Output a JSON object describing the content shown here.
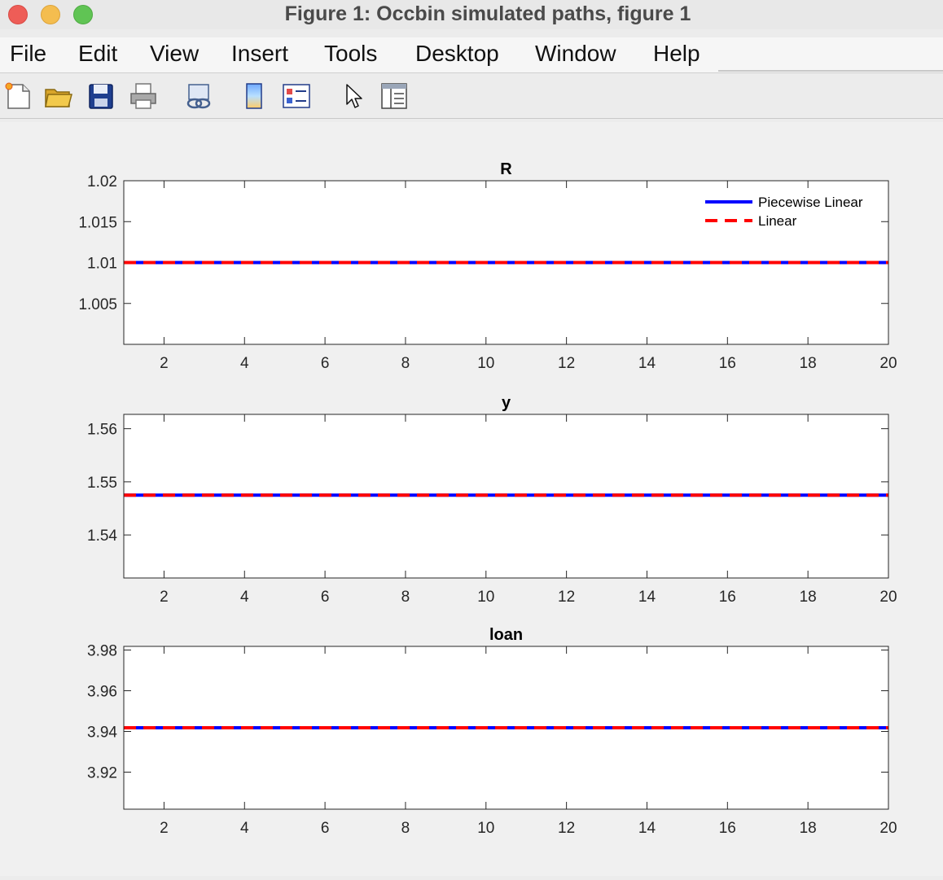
{
  "window": {
    "title": "Figure 1: Occbin simulated paths, figure 1"
  },
  "menu": [
    "File",
    "Edit",
    "View",
    "Insert",
    "Tools",
    "Desktop",
    "Window",
    "Help"
  ],
  "toolbar": [
    "new-figure-icon",
    "open-file-icon",
    "save-icon",
    "print-icon",
    "link-icon",
    "colorbar-icon",
    "legend-icon",
    "pointer-icon",
    "property-inspector-icon"
  ],
  "colors": {
    "piecewise": "#0000ff",
    "linear": "#ff0000"
  },
  "chart_data": [
    {
      "type": "line",
      "title": "R",
      "xlim": [
        1,
        20
      ],
      "ylim": [
        1,
        1.02
      ],
      "xticks": [
        2,
        4,
        6,
        8,
        10,
        12,
        14,
        16,
        18,
        20
      ],
      "yticks": [
        1.005,
        1.01,
        1.015,
        1.02
      ],
      "ytick_labels": [
        "1.005",
        "1.01",
        "1.015",
        "1.02"
      ],
      "legend": {
        "position": "top-right",
        "entries": [
          "Piecewise Linear",
          "Linear"
        ]
      },
      "series": [
        {
          "name": "Piecewise Linear",
          "style": "solid",
          "x": [
            1,
            20
          ],
          "y": [
            1.01,
            1.01
          ]
        },
        {
          "name": "Linear",
          "style": "dashed",
          "x": [
            1,
            20
          ],
          "y": [
            1.01,
            1.01
          ]
        }
      ]
    },
    {
      "type": "line",
      "title": "y",
      "xlim": [
        1,
        20
      ],
      "ylim": [
        1.5319,
        1.5627
      ],
      "xticks": [
        2,
        4,
        6,
        8,
        10,
        12,
        14,
        16,
        18,
        20
      ],
      "yticks": [
        1.54,
        1.55,
        1.56
      ],
      "ytick_labels": [
        "1.54",
        "1.55",
        "1.56"
      ],
      "series": [
        {
          "name": "Piecewise Linear",
          "style": "solid",
          "x": [
            1,
            20
          ],
          "y": [
            1.5475,
            1.5475
          ]
        },
        {
          "name": "Linear",
          "style": "dashed",
          "x": [
            1,
            20
          ],
          "y": [
            1.5475,
            1.5475
          ]
        }
      ]
    },
    {
      "type": "line",
      "title": "loan",
      "xlim": [
        1,
        20
      ],
      "ylim": [
        3.9018,
        3.9818
      ],
      "xticks": [
        2,
        4,
        6,
        8,
        10,
        12,
        14,
        16,
        18,
        20
      ],
      "yticks": [
        3.92,
        3.94,
        3.96,
        3.98
      ],
      "ytick_labels": [
        "3.92",
        "3.94",
        "3.96",
        "3.98"
      ],
      "series": [
        {
          "name": "Piecewise Linear",
          "style": "solid",
          "x": [
            1,
            20
          ],
          "y": [
            3.9418,
            3.9418
          ]
        },
        {
          "name": "Linear",
          "style": "dashed",
          "x": [
            1,
            20
          ],
          "y": [
            3.9418,
            3.9418
          ]
        }
      ]
    }
  ]
}
